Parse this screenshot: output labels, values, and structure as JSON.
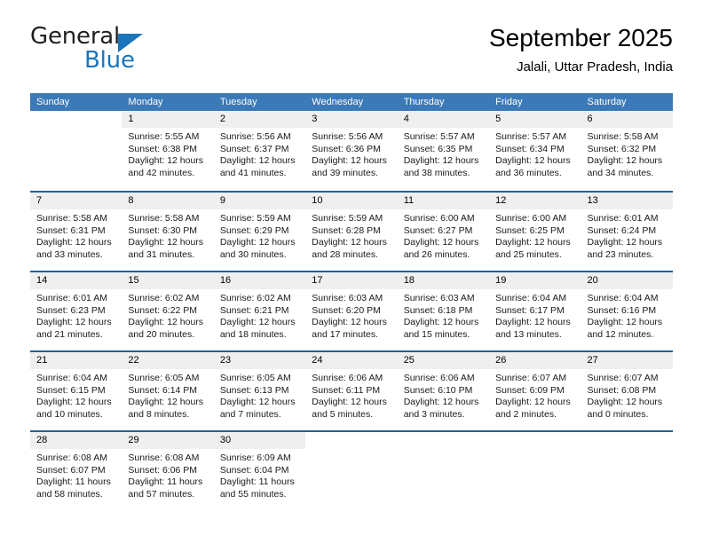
{
  "brand": {
    "name_part1": "General",
    "name_part2": "Blue",
    "accent_color": "#1b75bb"
  },
  "header": {
    "title": "September 2025",
    "subtitle": "Jalali, Uttar Pradesh, India"
  },
  "theme": {
    "header_band": "#3b79b8",
    "row_divider": "#20639b",
    "day_number_band": "#efefef"
  },
  "weekdays": [
    "Sunday",
    "Monday",
    "Tuesday",
    "Wednesday",
    "Thursday",
    "Friday",
    "Saturday"
  ],
  "weeks": [
    [
      {
        "day": "",
        "sunrise": "",
        "sunset": "",
        "daylight": "",
        "blank": true
      },
      {
        "day": "1",
        "sunrise": "Sunrise: 5:55 AM",
        "sunset": "Sunset: 6:38 PM",
        "daylight": "Daylight: 12 hours and 42 minutes."
      },
      {
        "day": "2",
        "sunrise": "Sunrise: 5:56 AM",
        "sunset": "Sunset: 6:37 PM",
        "daylight": "Daylight: 12 hours and 41 minutes."
      },
      {
        "day": "3",
        "sunrise": "Sunrise: 5:56 AM",
        "sunset": "Sunset: 6:36 PM",
        "daylight": "Daylight: 12 hours and 39 minutes."
      },
      {
        "day": "4",
        "sunrise": "Sunrise: 5:57 AM",
        "sunset": "Sunset: 6:35 PM",
        "daylight": "Daylight: 12 hours and 38 minutes."
      },
      {
        "day": "5",
        "sunrise": "Sunrise: 5:57 AM",
        "sunset": "Sunset: 6:34 PM",
        "daylight": "Daylight: 12 hours and 36 minutes."
      },
      {
        "day": "6",
        "sunrise": "Sunrise: 5:58 AM",
        "sunset": "Sunset: 6:32 PM",
        "daylight": "Daylight: 12 hours and 34 minutes."
      }
    ],
    [
      {
        "day": "7",
        "sunrise": "Sunrise: 5:58 AM",
        "sunset": "Sunset: 6:31 PM",
        "daylight": "Daylight: 12 hours and 33 minutes."
      },
      {
        "day": "8",
        "sunrise": "Sunrise: 5:58 AM",
        "sunset": "Sunset: 6:30 PM",
        "daylight": "Daylight: 12 hours and 31 minutes."
      },
      {
        "day": "9",
        "sunrise": "Sunrise: 5:59 AM",
        "sunset": "Sunset: 6:29 PM",
        "daylight": "Daylight: 12 hours and 30 minutes."
      },
      {
        "day": "10",
        "sunrise": "Sunrise: 5:59 AM",
        "sunset": "Sunset: 6:28 PM",
        "daylight": "Daylight: 12 hours and 28 minutes."
      },
      {
        "day": "11",
        "sunrise": "Sunrise: 6:00 AM",
        "sunset": "Sunset: 6:27 PM",
        "daylight": "Daylight: 12 hours and 26 minutes."
      },
      {
        "day": "12",
        "sunrise": "Sunrise: 6:00 AM",
        "sunset": "Sunset: 6:25 PM",
        "daylight": "Daylight: 12 hours and 25 minutes."
      },
      {
        "day": "13",
        "sunrise": "Sunrise: 6:01 AM",
        "sunset": "Sunset: 6:24 PM",
        "daylight": "Daylight: 12 hours and 23 minutes."
      }
    ],
    [
      {
        "day": "14",
        "sunrise": "Sunrise: 6:01 AM",
        "sunset": "Sunset: 6:23 PM",
        "daylight": "Daylight: 12 hours and 21 minutes."
      },
      {
        "day": "15",
        "sunrise": "Sunrise: 6:02 AM",
        "sunset": "Sunset: 6:22 PM",
        "daylight": "Daylight: 12 hours and 20 minutes."
      },
      {
        "day": "16",
        "sunrise": "Sunrise: 6:02 AM",
        "sunset": "Sunset: 6:21 PM",
        "daylight": "Daylight: 12 hours and 18 minutes."
      },
      {
        "day": "17",
        "sunrise": "Sunrise: 6:03 AM",
        "sunset": "Sunset: 6:20 PM",
        "daylight": "Daylight: 12 hours and 17 minutes."
      },
      {
        "day": "18",
        "sunrise": "Sunrise: 6:03 AM",
        "sunset": "Sunset: 6:18 PM",
        "daylight": "Daylight: 12 hours and 15 minutes."
      },
      {
        "day": "19",
        "sunrise": "Sunrise: 6:04 AM",
        "sunset": "Sunset: 6:17 PM",
        "daylight": "Daylight: 12 hours and 13 minutes."
      },
      {
        "day": "20",
        "sunrise": "Sunrise: 6:04 AM",
        "sunset": "Sunset: 6:16 PM",
        "daylight": "Daylight: 12 hours and 12 minutes."
      }
    ],
    [
      {
        "day": "21",
        "sunrise": "Sunrise: 6:04 AM",
        "sunset": "Sunset: 6:15 PM",
        "daylight": "Daylight: 12 hours and 10 minutes."
      },
      {
        "day": "22",
        "sunrise": "Sunrise: 6:05 AM",
        "sunset": "Sunset: 6:14 PM",
        "daylight": "Daylight: 12 hours and 8 minutes."
      },
      {
        "day": "23",
        "sunrise": "Sunrise: 6:05 AM",
        "sunset": "Sunset: 6:13 PM",
        "daylight": "Daylight: 12 hours and 7 minutes."
      },
      {
        "day": "24",
        "sunrise": "Sunrise: 6:06 AM",
        "sunset": "Sunset: 6:11 PM",
        "daylight": "Daylight: 12 hours and 5 minutes."
      },
      {
        "day": "25",
        "sunrise": "Sunrise: 6:06 AM",
        "sunset": "Sunset: 6:10 PM",
        "daylight": "Daylight: 12 hours and 3 minutes."
      },
      {
        "day": "26",
        "sunrise": "Sunrise: 6:07 AM",
        "sunset": "Sunset: 6:09 PM",
        "daylight": "Daylight: 12 hours and 2 minutes."
      },
      {
        "day": "27",
        "sunrise": "Sunrise: 6:07 AM",
        "sunset": "Sunset: 6:08 PM",
        "daylight": "Daylight: 12 hours and 0 minutes."
      }
    ],
    [
      {
        "day": "28",
        "sunrise": "Sunrise: 6:08 AM",
        "sunset": "Sunset: 6:07 PM",
        "daylight": "Daylight: 11 hours and 58 minutes."
      },
      {
        "day": "29",
        "sunrise": "Sunrise: 6:08 AM",
        "sunset": "Sunset: 6:06 PM",
        "daylight": "Daylight: 11 hours and 57 minutes."
      },
      {
        "day": "30",
        "sunrise": "Sunrise: 6:09 AM",
        "sunset": "Sunset: 6:04 PM",
        "daylight": "Daylight: 11 hours and 55 minutes."
      },
      {
        "day": "",
        "sunrise": "",
        "sunset": "",
        "daylight": "",
        "blank": true
      },
      {
        "day": "",
        "sunrise": "",
        "sunset": "",
        "daylight": "",
        "blank": true
      },
      {
        "day": "",
        "sunrise": "",
        "sunset": "",
        "daylight": "",
        "blank": true
      },
      {
        "day": "",
        "sunrise": "",
        "sunset": "",
        "daylight": "",
        "blank": true
      }
    ]
  ]
}
